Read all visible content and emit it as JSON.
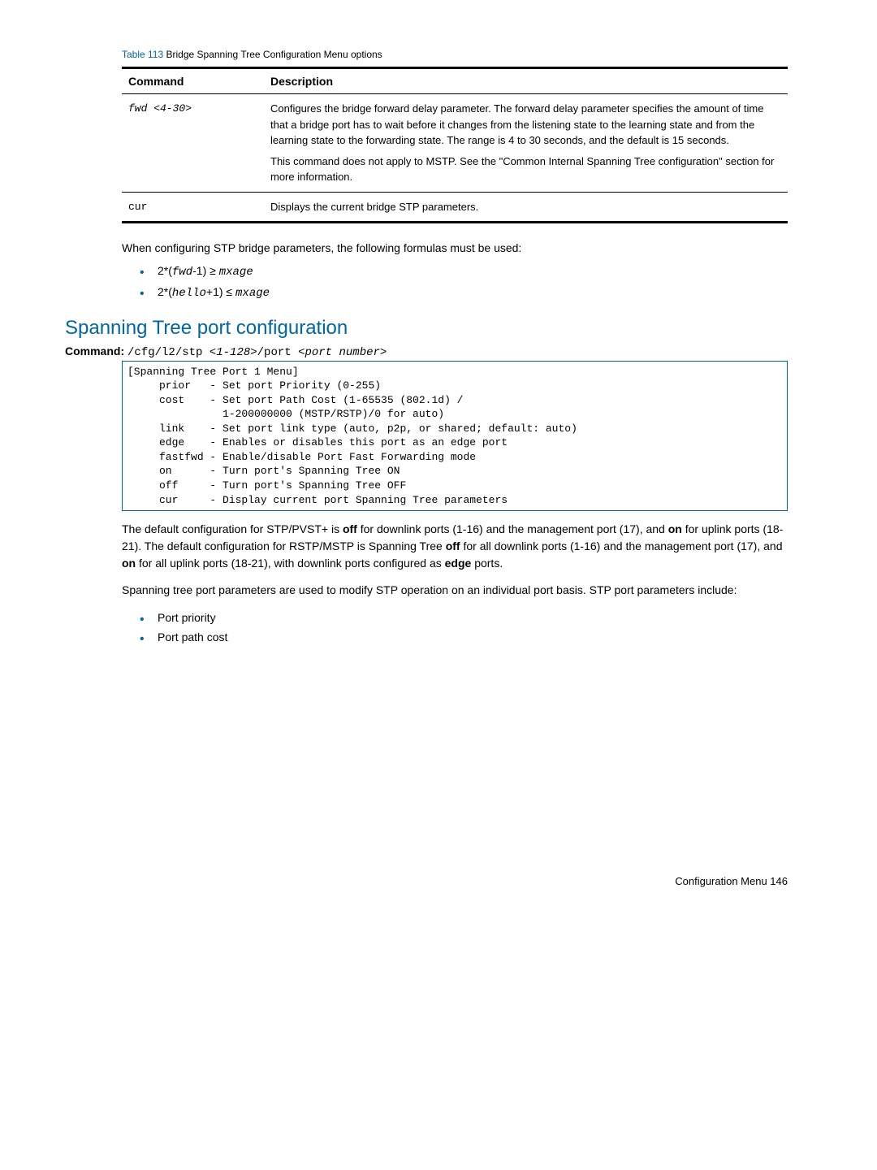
{
  "table": {
    "caption_label": "Table 113",
    "caption_text": "Bridge Spanning Tree Configuration Menu options",
    "headers": [
      "Command",
      "Description"
    ],
    "rows": [
      {
        "cmd": "fwd <4-30>",
        "desc_p1": "Configures the bridge forward delay parameter. The forward delay parameter specifies the amount of time that a bridge port has to wait before it changes from the listening state to the learning state and from the learning state to the forwarding state. The range is 4 to 30 seconds, and the default is 15 seconds.",
        "desc_p2": "This command does not apply to MSTP. See the \"Common Internal Spanning Tree configuration\" section for more information."
      },
      {
        "cmd": "cur",
        "desc_p1": "Displays the current bridge STP parameters.",
        "desc_p2": ""
      }
    ]
  },
  "intro_text": "When configuring STP bridge parameters, the following formulas must be used:",
  "formulas": {
    "f1_pre": "2*(",
    "f1_var": "fwd",
    "f1_mid": "-1) ≥ ",
    "f1_var2": "mxage",
    "f2_pre": "2*(",
    "f2_var": "hello",
    "f2_mid": "+1) ≤ ",
    "f2_var2": "mxage"
  },
  "section_heading": "Spanning Tree port configuration",
  "command": {
    "label": "Command:",
    "text_pre": "/cfg/l2/stp ",
    "text_var1": "<1-128>",
    "text_mid": "/port ",
    "text_var2": "<port number>"
  },
  "code_block": "[Spanning Tree Port 1 Menu]\n     prior   - Set port Priority (0-255)\n     cost    - Set port Path Cost (1-65535 (802.1d) /\n               1-200000000 (MSTP/RSTP)/0 for auto)\n     link    - Set port link type (auto, p2p, or shared; default: auto)\n     edge    - Enables or disables this port as an edge port\n     fastfwd - Enable/disable Port Fast Forwarding mode\n     on      - Turn port's Spanning Tree ON\n     off     - Turn port's Spanning Tree OFF\n     cur     - Display current port Spanning Tree parameters",
  "para1": {
    "t1": "The default configuration for STP/PVST+ is ",
    "b1": "off",
    "t2": " for downlink ports (1-16) and the management port (17), and ",
    "b2": "on",
    "t3": " for uplink ports (18-21). The default configuration for RSTP/MSTP is Spanning Tree ",
    "b3": "off",
    "t4": " for all downlink ports (1-16) and the management port (17), and ",
    "b4": "on",
    "t5": " for all uplink ports (18-21), with downlink ports configured as ",
    "b5": "edge",
    "t6": " ports."
  },
  "para2": "Spanning tree port parameters are used to modify STP operation on an individual port basis. STP port parameters include:",
  "bullets2": [
    "Port priority",
    "Port path cost"
  ],
  "footer": "Configuration Menu   146"
}
